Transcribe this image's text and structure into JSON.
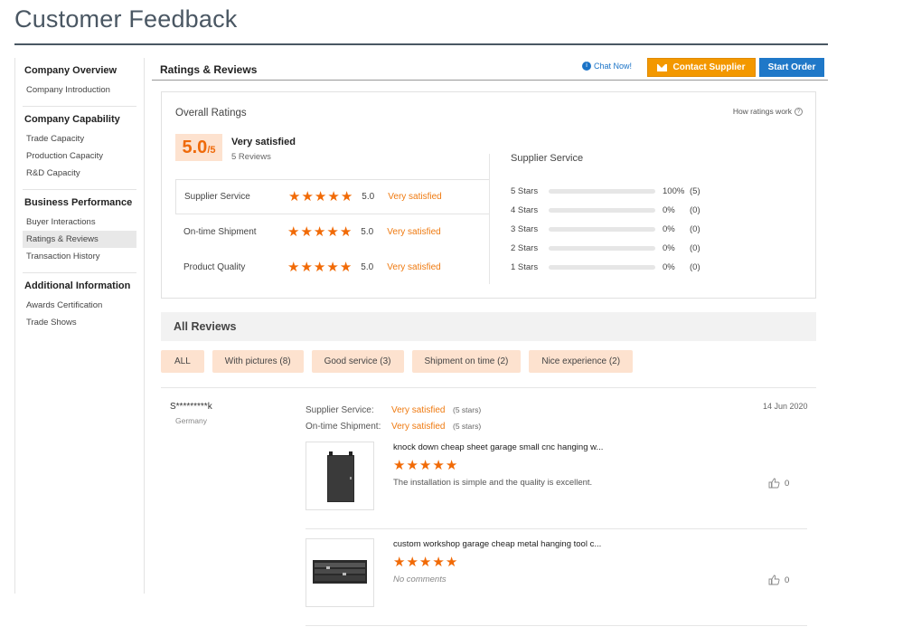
{
  "page": {
    "title": "Customer Feedback"
  },
  "sidebar": {
    "groups": [
      {
        "heading": "Company Overview",
        "items": [
          "Company Introduction"
        ]
      },
      {
        "heading": "Company Capability",
        "items": [
          "Trade Capacity",
          "Production Capacity",
          "R&D Capacity"
        ]
      },
      {
        "heading": "Business Performance",
        "items": [
          "Buyer Interactions",
          "Ratings & Reviews",
          "Transaction History"
        ]
      },
      {
        "heading": "Additional Information",
        "items": [
          "Awards Certification",
          "Trade Shows"
        ]
      }
    ],
    "active_item": "Ratings & Reviews"
  },
  "header": {
    "title": "Ratings & Reviews",
    "chat_label": "Chat Now!",
    "contact_label": "Contact Supplier",
    "order_label": "Start Order"
  },
  "overall": {
    "label": "Overall Ratings",
    "how_label": "How ratings work",
    "score": "5.0",
    "score_max": "/5",
    "satisfaction": "Very satisfied",
    "review_count": "5 Reviews",
    "subratings": [
      {
        "label": "Supplier Service",
        "stars": 5,
        "value": "5.0",
        "text": "Very satisfied"
      },
      {
        "label": "On-time Shipment",
        "stars": 5,
        "value": "5.0",
        "text": "Very satisfied"
      },
      {
        "label": "Product Quality",
        "stars": 5,
        "value": "5.0",
        "text": "Very satisfied"
      }
    ]
  },
  "supplier_service": {
    "title": "Supplier Service",
    "distribution": [
      {
        "label": "5 Stars",
        "fraction": 1.0,
        "pct": "100%",
        "count": "(5)"
      },
      {
        "label": "4 Stars",
        "fraction": 0,
        "pct": "0%",
        "count": "(0)"
      },
      {
        "label": "3 Stars",
        "fraction": 0,
        "pct": "0%",
        "count": "(0)"
      },
      {
        "label": "2 Stars",
        "fraction": 0,
        "pct": "0%",
        "count": "(0)"
      },
      {
        "label": "1 Stars",
        "fraction": 0,
        "pct": "0%",
        "count": "(0)"
      }
    ]
  },
  "all_reviews": {
    "title": "All Reviews",
    "filters": [
      "ALL",
      "With pictures (8)",
      "Good service (3)",
      "Shipment on time (2)",
      "Nice experience (2)"
    ]
  },
  "review": {
    "reviewer": "S*********k",
    "country": "Germany",
    "date": "14 Jun 2020",
    "service_key": "Supplier Service:",
    "service_val": "Very satisfied",
    "service_stars": "(5 stars)",
    "shipment_key": "On-time Shipment:",
    "shipment_val": "Very satisfied",
    "shipment_stars": "(5 stars)",
    "products": [
      {
        "name": "knock down cheap sheet garage small cnc hanging w...",
        "stars": 5,
        "comment": "The installation is simple and the quality is excellent.",
        "likes": "0"
      },
      {
        "name": "custom workshop garage cheap metal hanging tool c...",
        "stars": 5,
        "comment": "No comments",
        "likes": "0"
      }
    ]
  },
  "colors": {
    "accent": "#ef6a0a",
    "blue": "#1f78c8",
    "chip": "#fde2cf"
  }
}
